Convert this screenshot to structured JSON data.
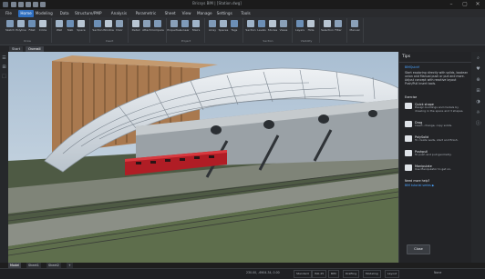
{
  "window": {
    "title": "Bricsys BIM | [Station.dwg]",
    "controls": [
      "–",
      "▢",
      "✕"
    ]
  },
  "ribbon_tabs": [
    {
      "label": "File",
      "active": false
    },
    {
      "label": "Home",
      "active": true
    },
    {
      "label": "Modeling",
      "active": false
    },
    {
      "label": "Data",
      "active": false
    },
    {
      "label": "Structure/PMP",
      "active": false
    },
    {
      "label": "Analysis",
      "active": false
    },
    {
      "label": "Parametric",
      "active": false
    },
    {
      "label": "Sheet",
      "active": false
    },
    {
      "label": "View",
      "active": false
    },
    {
      "label": "Manage",
      "active": false
    },
    {
      "label": "Settings",
      "active": false
    },
    {
      "label": "Tools",
      "active": false
    }
  ],
  "ribbon_groups": [
    {
      "label": "Draw",
      "buttons": [
        "Sketch",
        "Polyline",
        "Fillet",
        "Circle"
      ]
    },
    {
      "label": "",
      "buttons": [
        "Wall",
        "Slab",
        "Space"
      ]
    },
    {
      "label": "Insert",
      "buttons": [
        "Section",
        "Window",
        "Door"
      ]
    },
    {
      "label": "",
      "buttons": [
        "Detail",
        "Attach",
        "Compare"
      ]
    },
    {
      "label": "Project",
      "buttons": [
        "Properties",
        "Linear",
        "Stairs"
      ]
    },
    {
      "label": "",
      "buttons": [
        "Array",
        "Spaces",
        "Tags"
      ]
    },
    {
      "label": "Section",
      "buttons": [
        "Section",
        "Levels",
        "Stories",
        "Views"
      ]
    },
    {
      "label": "Visibility",
      "buttons": [
        "Layers",
        "Hide"
      ]
    },
    {
      "label": "",
      "buttons": [
        "Selection",
        "Filter"
      ]
    },
    {
      "label": "",
      "buttons": [
        "Manual"
      ]
    }
  ],
  "doc_tabs": [
    "Start",
    "Overall"
  ],
  "left_tools": [
    "☰",
    "⊞",
    "⬚"
  ],
  "tips_panel": {
    "header": "Tips",
    "intro_link": "BIMQuickf",
    "intro": "Start exploring directly with solids, boolean union and Manual push or pull and more. Adjust concept with reactive layout Push/Pull Insert tools.",
    "section_label": "Exercise",
    "tips": [
      {
        "name": "Quick shape",
        "desc": "Design buildings and models by drawing in the space and 3 shapes."
      },
      {
        "name": "Drag",
        "desc": "Insert, change, copy solids."
      },
      {
        "name": "PolySolid",
        "desc": "To create walls, start and finish."
      },
      {
        "name": "Pushpull",
        "desc": "To push and pull geometry."
      },
      {
        "name": "Manipulate",
        "desc": "Use Manipulator to get on."
      }
    ],
    "more_link_label": "Need more help?",
    "more_link": "BIM tutorial series ▶",
    "close_label": "Close"
  },
  "right_icons": [
    "⌕",
    "♥",
    "⊕",
    "⊞",
    "◑",
    "☼",
    "ⓘ"
  ],
  "layout_tabs": [
    {
      "label": "Model",
      "active": true
    },
    {
      "label": "Sheet1",
      "active": false
    },
    {
      "label": "Sheet2",
      "active": false
    },
    {
      "label": "+",
      "active": false
    }
  ],
  "status": {
    "coords": "230.00, -6904.34, 0.00",
    "mode_boxes": [
      "Standard",
      "ISO-25",
      "BIM",
      "Drafting",
      "Modeling",
      "Layout"
    ],
    "right_text": "None"
  },
  "colors": {
    "accent": "#2f6fc0",
    "train": "#b01d25",
    "sky": "#b3c7d9",
    "ground": "#5c6b4a"
  }
}
